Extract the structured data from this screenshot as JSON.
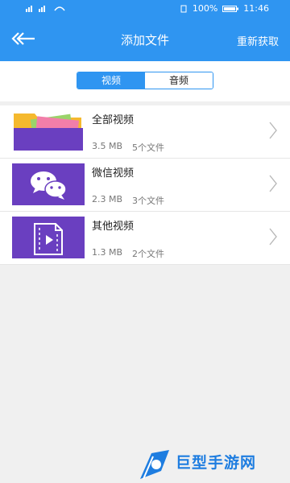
{
  "status_bar": {
    "battery": "100%",
    "time": "11:46"
  },
  "header": {
    "title": "添加文件",
    "refresh_label": "重新获取"
  },
  "tabs": [
    {
      "label": "视频",
      "active": true
    },
    {
      "label": "音频",
      "active": false
    }
  ],
  "folders": [
    {
      "name": "全部视频",
      "size": "3.5 MB",
      "count": "5个文件",
      "icon": "folder-icon"
    },
    {
      "name": "微信视频",
      "size": "2.3 MB",
      "count": "3个文件",
      "icon": "wechat-icon"
    },
    {
      "name": "其他视频",
      "size": "1.3 MB",
      "count": "2个文件",
      "icon": "video-file-icon"
    }
  ],
  "watermark": {
    "text": "巨型手游网"
  },
  "colors": {
    "primary": "#2f95f1",
    "thumb_purple": "#6a3fc0",
    "watermark": "#1e7de0"
  }
}
